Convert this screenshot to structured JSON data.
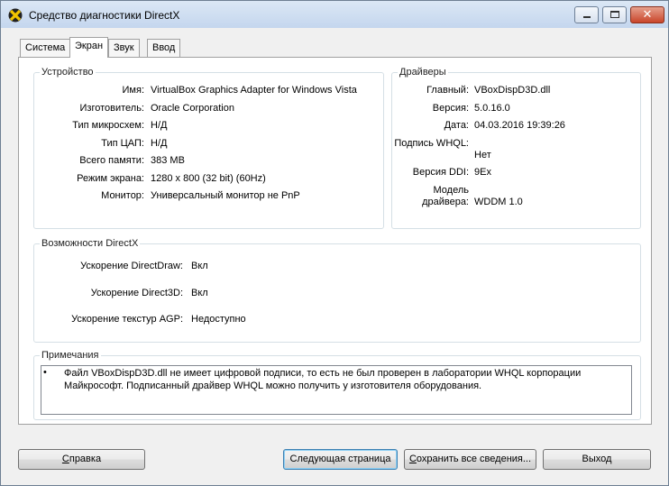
{
  "window": {
    "title": "Средство диагностики DirectX"
  },
  "tabs": [
    {
      "label": "Система",
      "active": false
    },
    {
      "label": "Экран",
      "active": true
    },
    {
      "label": "Звук",
      "active": false
    },
    {
      "label": "Ввод",
      "active": false
    }
  ],
  "device": {
    "title": "Устройство",
    "rows": [
      {
        "label": "Имя:",
        "value": "VirtualBox Graphics Adapter for Windows Vista"
      },
      {
        "label": "Изготовитель:",
        "value": "Oracle Corporation"
      },
      {
        "label": "Тип микросхем:",
        "value": "Н/Д"
      },
      {
        "label": "Тип ЦАП:",
        "value": "Н/Д"
      },
      {
        "label": "Всего памяти:",
        "value": "383 MB"
      },
      {
        "label": "Режим экрана:",
        "value": "1280 x 800 (32 bit) (60Hz)"
      },
      {
        "label": "Монитор:",
        "value": "Универсальный монитор не PnP"
      }
    ]
  },
  "drivers": {
    "title": "Драйверы",
    "main_label": "Главный:",
    "main_value": "VBoxDispD3D.dll",
    "version_label": "Версия:",
    "version_value": "5.0.16.0",
    "date_label": "Дата:",
    "date_value": "04.03.2016 19:39:26",
    "whql_label": "Подпись WHQL:",
    "whql_value": "Нет",
    "ddi_label": "Версия DDI:",
    "ddi_value": "9Ex",
    "model_label_1": "Модель",
    "model_label_2": "драйвера:",
    "model_value": "WDDM 1.0"
  },
  "features": {
    "title": "Возможности DirectX",
    "rows": [
      {
        "label": "Ускорение DirectDraw:",
        "value": "Вкл"
      },
      {
        "label": "Ускорение Direct3D:",
        "value": "Вкл"
      },
      {
        "label": "Ускорение текстур AGP:",
        "value": "Недоступно"
      }
    ]
  },
  "notes": {
    "title": "Примечания",
    "bullet": "•",
    "line1": "Файл VBoxDispD3D.dll не имеет цифровой подписи, то есть не был проверен в лаборатории WHQL корпорации",
    "line2": "Майкрософт. Подписанный драйвер WHQL можно получить у изготовителя оборудования."
  },
  "buttons": {
    "help_first": "С",
    "help_rest": "правка",
    "next_page": "Следующая страница",
    "save_first": "С",
    "save_rest": "охранить все сведения...",
    "exit": "Выход"
  },
  "colors": {
    "title_bar": "#c4d6ee",
    "close_button": "#c9452a",
    "panel_border": "#d5dfe5"
  }
}
